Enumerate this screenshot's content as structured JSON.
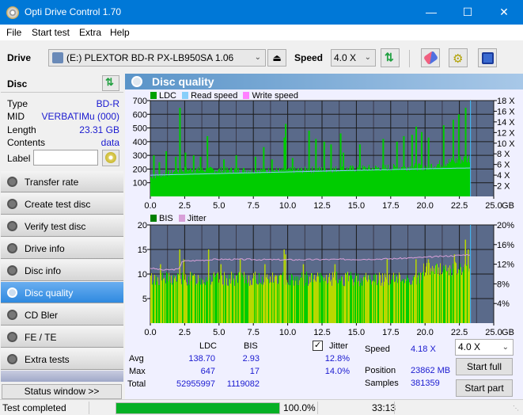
{
  "window": {
    "title": "Opti Drive Control 1.70",
    "minimize": "—",
    "maximize": "☐",
    "close": "✕"
  },
  "menu": [
    "File",
    "Start test",
    "Extra",
    "Help"
  ],
  "toolbar": {
    "drive_label": "Drive",
    "drive_value": "(E:)  PLEXTOR BD-R  PX-LB950SA 1.06",
    "speed_label": "Speed",
    "speed_value": "4.0 X"
  },
  "disc": {
    "header": "Disc",
    "rows": [
      {
        "key": "Type",
        "value": "BD-R"
      },
      {
        "key": "MID",
        "value": "VERBATIMu (000)"
      },
      {
        "key": "Length",
        "value": "23.31 GB"
      },
      {
        "key": "Contents",
        "value": "data"
      }
    ],
    "label_key": "Label",
    "label_value": ""
  },
  "nav": [
    {
      "label": "Transfer rate",
      "active": false
    },
    {
      "label": "Create test disc",
      "active": false
    },
    {
      "label": "Verify test disc",
      "active": false
    },
    {
      "label": "Drive info",
      "active": false
    },
    {
      "label": "Disc info",
      "active": false
    },
    {
      "label": "Disc quality",
      "active": true
    },
    {
      "label": "CD Bler",
      "active": false
    },
    {
      "label": "FE / TE",
      "active": false
    },
    {
      "label": "Extra tests",
      "active": false
    }
  ],
  "status_window_button": "Status window >>",
  "panel": {
    "title": "Disc quality"
  },
  "colors": {
    "ldc": "#00a000",
    "read_speed": "#87cefa",
    "write_speed": "#ff80ff",
    "bis": "#008000",
    "jitter": "#d8a0d8",
    "plot_bg": "#5a6a8a",
    "bar_green": "#00cc00",
    "bar_yellow": "#b8d800"
  },
  "chart_data": [
    {
      "type": "bar",
      "title": "LDC",
      "legend": [
        "LDC",
        "Read speed",
        "Write speed"
      ],
      "legend_placement": "top-left",
      "xlabel": "GB",
      "x_ticks": [
        "0.0",
        "2.5",
        "5.0",
        "7.5",
        "10.0",
        "12.5",
        "15.0",
        "17.5",
        "20.0",
        "22.5",
        "25.0"
      ],
      "xlim": [
        0,
        25
      ],
      "ylim_left": [
        0,
        700
      ],
      "y_ticks_left": [
        "100",
        "200",
        "300",
        "400",
        "500",
        "600",
        "700"
      ],
      "ylim_right": [
        0,
        18
      ],
      "y_ticks_right": [
        "2 X",
        "4 X",
        "6 X",
        "8 X",
        "10 X",
        "12 X",
        "14 X",
        "16 X",
        "18 X"
      ],
      "grid": true,
      "data_end_gb": 23.31,
      "ldc_baseline": [
        [
          0,
          150
        ],
        [
          2.5,
          205
        ],
        [
          10,
          200
        ],
        [
          20,
          230
        ],
        [
          22,
          270
        ],
        [
          23.31,
          300
        ]
      ],
      "ldc_spikes": [
        [
          0.2,
          300
        ],
        [
          0.6,
          250
        ],
        [
          1.1,
          330
        ],
        [
          1.8,
          290
        ],
        [
          2.1,
          647
        ],
        [
          2.5,
          320
        ],
        [
          3.1,
          300
        ],
        [
          3.6,
          290
        ],
        [
          4.1,
          440
        ],
        [
          5.3,
          270
        ],
        [
          6.2,
          300
        ],
        [
          7.6,
          290
        ],
        [
          8.2,
          360
        ],
        [
          8.8,
          270
        ],
        [
          9.7,
          430
        ],
        [
          9.8,
          530
        ],
        [
          10.3,
          280
        ],
        [
          11.5,
          480
        ],
        [
          12.0,
          420
        ],
        [
          12.6,
          400
        ],
        [
          13.1,
          380
        ],
        [
          13.8,
          460
        ],
        [
          14.0,
          320
        ],
        [
          15.2,
          380
        ],
        [
          16.9,
          420
        ],
        [
          17.9,
          400
        ],
        [
          18.4,
          440
        ],
        [
          19.0,
          450
        ],
        [
          19.3,
          510
        ],
        [
          19.7,
          470
        ],
        [
          20.2,
          430
        ],
        [
          21.3,
          520
        ],
        [
          22.0,
          560
        ],
        [
          22.4,
          600
        ],
        [
          22.9,
          647
        ]
      ],
      "read_speed": [
        [
          0,
          4.0
        ],
        [
          2.5,
          4.15
        ],
        [
          5,
          4.3
        ],
        [
          7.5,
          4.45
        ],
        [
          10,
          4.6
        ],
        [
          12.5,
          4.75
        ],
        [
          15,
          4.9
        ],
        [
          17.5,
          5.05
        ],
        [
          20,
          5.2
        ],
        [
          23.31,
          5.35
        ]
      ]
    },
    {
      "type": "bar",
      "title": "BIS",
      "legend": [
        "BIS",
        "Jitter"
      ],
      "legend_placement": "top-left",
      "xlabel": "GB",
      "x_ticks": [
        "0.0",
        "2.5",
        "5.0",
        "7.5",
        "10.0",
        "12.5",
        "15.0",
        "17.5",
        "20.0",
        "22.5",
        "25.0"
      ],
      "xlim": [
        0,
        25
      ],
      "ylim_left": [
        0,
        20
      ],
      "y_ticks_left": [
        "5",
        "10",
        "15",
        "20"
      ],
      "ylim_right_percent": [
        0,
        20
      ],
      "y_ticks_right": [
        "4%",
        "8%",
        "12%",
        "16%",
        "20%"
      ],
      "grid": true,
      "data_end_gb": 23.31,
      "bis_baseline": 9,
      "bis_spikes": [
        [
          0.7,
          12
        ],
        [
          2.1,
          15
        ],
        [
          2.4,
          13
        ],
        [
          4.2,
          15
        ],
        [
          5.1,
          12
        ],
        [
          6.5,
          13
        ],
        [
          8.3,
          12
        ],
        [
          9.7,
          15
        ],
        [
          9.8,
          14
        ],
        [
          11.1,
          12
        ],
        [
          13.4,
          12
        ],
        [
          17.2,
          13
        ],
        [
          19.3,
          13
        ],
        [
          20.2,
          13
        ],
        [
          22.1,
          14
        ],
        [
          22.9,
          17
        ],
        [
          23.1,
          15
        ]
      ],
      "jitter_percent": [
        [
          0,
          11.2
        ],
        [
          1,
          10.8
        ],
        [
          2.1,
          11.0
        ],
        [
          2.3,
          12.6
        ],
        [
          5,
          13.0
        ],
        [
          10,
          12.9
        ],
        [
          15,
          13.0
        ],
        [
          17.5,
          13.1
        ],
        [
          20,
          13.4
        ],
        [
          22.5,
          13.8
        ],
        [
          23.31,
          14.0
        ]
      ]
    }
  ],
  "stats": {
    "col_ldc": "LDC",
    "col_bis": "BIS",
    "jitter_label": "Jitter",
    "jitter_checked": true,
    "rows": [
      {
        "label": "Avg",
        "ldc": "138.70",
        "bis": "2.93",
        "jitter": "12.8%"
      },
      {
        "label": "Max",
        "ldc": "647",
        "bis": "17",
        "jitter": "14.0%"
      },
      {
        "label": "Total",
        "ldc": "52955997",
        "bis": "1119082",
        "jitter": ""
      }
    ],
    "speed_label": "Speed",
    "speed_value": "4.18 X",
    "position_label": "Position",
    "position_value": "23862 MB",
    "samples_label": "Samples",
    "samples_value": "381359",
    "speed_select": "4.0 X",
    "start_full": "Start full",
    "start_part": "Start part"
  },
  "statusbar": {
    "text": "Test completed",
    "progress_percent": 100.0,
    "progress_label": "100.0%",
    "elapsed": "33:13"
  }
}
